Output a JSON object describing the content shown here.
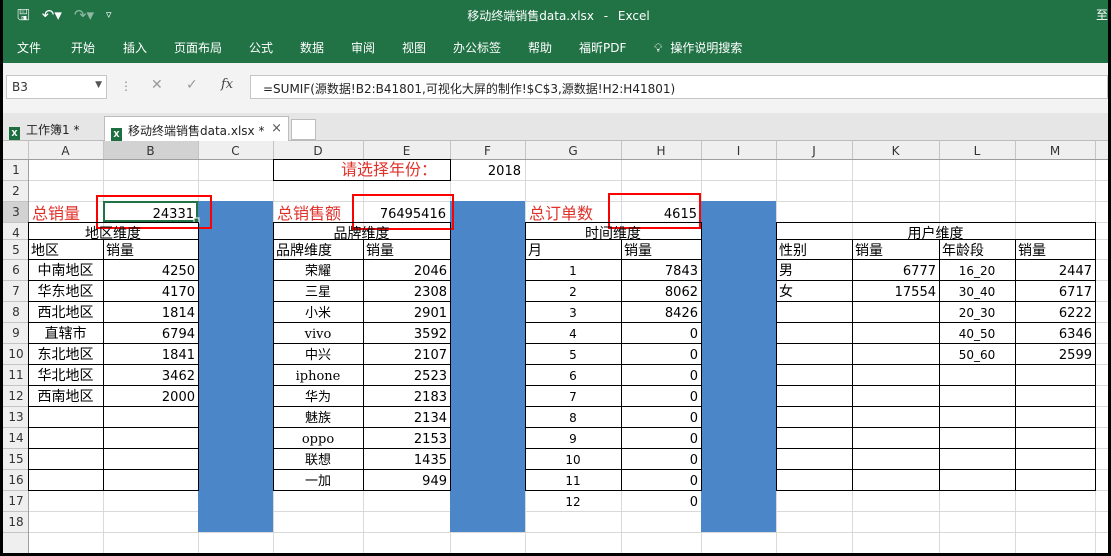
{
  "app": {
    "title": "移动终端销售data.xlsx",
    "app_name": "Excel",
    "right_text": "至"
  },
  "ribbon": {
    "tabs": [
      "文件",
      "开始",
      "插入",
      "页面布局",
      "公式",
      "数据",
      "审阅",
      "视图",
      "办公标签",
      "帮助",
      "福昕PDF",
      "操作说明搜索"
    ]
  },
  "formula_bar": {
    "name_box": "B3",
    "formula": "=SUMIF(源数据!B2:B41801,可视化大屏的制作!$C$3,源数据!H2:H41801)"
  },
  "doc_tabs": {
    "tab1": "工作簿1 *",
    "tab2": "移动终端销售data.xlsx *",
    "close": "×"
  },
  "colors": {
    "ribbon_green": "#217346",
    "label_red": "#e0322b",
    "highlight_box": "#ff0000",
    "separator_blue": "#4a86c8",
    "selected_cell_border": "#217346"
  },
  "sheet": {
    "columns": [
      "A",
      "B",
      "C",
      "D",
      "E",
      "F",
      "G",
      "H",
      "I",
      "J",
      "K",
      "L",
      "M"
    ],
    "rows": [
      "1",
      "2",
      "3",
      "4",
      "5",
      "6",
      "7",
      "8",
      "9",
      "10",
      "11",
      "12",
      "13",
      "14",
      "15",
      "16",
      "17",
      "18"
    ],
    "year": {
      "label": "请选择年份：",
      "value": "2018"
    },
    "kpis": [
      {
        "label": "总销量",
        "value": "24331"
      },
      {
        "label": "总销售额",
        "value": "76495416"
      },
      {
        "label": "总订单数",
        "value": "4615"
      }
    ],
    "region": {
      "title": "地区维度",
      "headers": [
        "地区",
        "销量"
      ],
      "rows": [
        [
          "中南地区",
          "4250"
        ],
        [
          "华东地区",
          "4170"
        ],
        [
          "西北地区",
          "1814"
        ],
        [
          "直辖市",
          "6794"
        ],
        [
          "东北地区",
          "1841"
        ],
        [
          "华北地区",
          "3462"
        ],
        [
          "西南地区",
          "2000"
        ]
      ]
    },
    "brand": {
      "title": "品牌维度",
      "headers": [
        "品牌维度",
        "销量"
      ],
      "rows": [
        [
          "荣耀",
          "2046"
        ],
        [
          "三星",
          "2308"
        ],
        [
          "小米",
          "2901"
        ],
        [
          "vivo",
          "3592"
        ],
        [
          "中兴",
          "2107"
        ],
        [
          "iphone",
          "2523"
        ],
        [
          "华为",
          "2183"
        ],
        [
          "魅族",
          "2134"
        ],
        [
          "oppo",
          "2153"
        ],
        [
          "联想",
          "1435"
        ],
        [
          "一加",
          "949"
        ]
      ]
    },
    "time": {
      "title": "时间维度",
      "headers": [
        "月",
        "销量"
      ],
      "rows": [
        [
          "1",
          "7843"
        ],
        [
          "2",
          "8062"
        ],
        [
          "3",
          "8426"
        ],
        [
          "4",
          "0"
        ],
        [
          "5",
          "0"
        ],
        [
          "6",
          "0"
        ],
        [
          "7",
          "0"
        ],
        [
          "8",
          "0"
        ],
        [
          "9",
          "0"
        ],
        [
          "10",
          "0"
        ],
        [
          "11",
          "0"
        ],
        [
          "12",
          "0"
        ]
      ]
    },
    "user": {
      "title": "用户维度",
      "headers": [
        "性别",
        "销量",
        "年龄段",
        "销量"
      ],
      "gender_rows": [
        [
          "男",
          "6777"
        ],
        [
          "女",
          "17554"
        ]
      ],
      "age_rows": [
        [
          "16_20",
          "2447"
        ],
        [
          "30_40",
          "6717"
        ],
        [
          "20_30",
          "6222"
        ],
        [
          "40_50",
          "6346"
        ],
        [
          "50_60",
          "2599"
        ]
      ]
    }
  }
}
